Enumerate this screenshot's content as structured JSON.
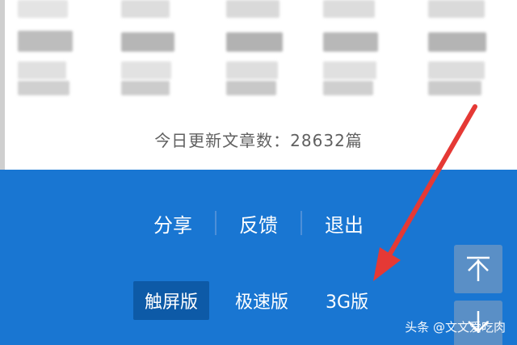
{
  "stats": {
    "update_text": "今日更新文章数：28632篇"
  },
  "footer_links": [
    {
      "label": "分享"
    },
    {
      "label": "反馈"
    },
    {
      "label": "退出"
    }
  ],
  "versions": [
    {
      "label": "触屏版",
      "active": true
    },
    {
      "label": "极速版",
      "active": false
    },
    {
      "label": "3G版",
      "active": false
    }
  ],
  "scroll_buttons": {
    "up_icon": "arrow-to-top-icon",
    "down_icon": "arrow-to-bottom-icon"
  },
  "annotation": {
    "color": "#e53935"
  },
  "watermark": "头条 @文文爱吃肉",
  "colors": {
    "blue_panel": "#1976d2",
    "active_version": "#0d5aa7",
    "scroll_button": "#5a8fc6"
  }
}
